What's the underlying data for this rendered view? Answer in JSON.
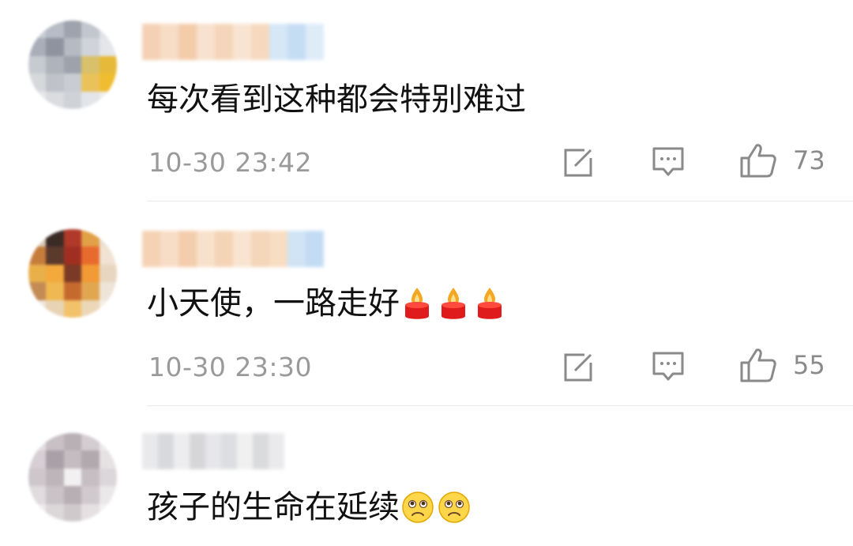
{
  "comments": [
    {
      "text": "每次看到这种都会特别难过",
      "emojis": [],
      "timestamp": "10-30 23:42",
      "likes": "73",
      "avatar_colors": [
        "#c9ccd3",
        "#b8bcc6",
        "#9ea3ad",
        "#c2c6cf",
        "#dfe1e5",
        "#a9aeb8",
        "#8e949f",
        "#b6bac3",
        "#d0d3d9",
        "#e4e6ea",
        "#c7cad1",
        "#aeb3bc",
        "#9da2ab",
        "#d8c16a",
        "#e7b93a",
        "#d6d8dc",
        "#bfc2c9",
        "#c9ccd2",
        "#e9c25a",
        "#f0bd31",
        "#e7e8ea",
        "#dadce0",
        "#cfd2d7",
        "#e4e5e8",
        "#eeeeef"
      ],
      "username_colors": [
        "#f3c9a8",
        "#f6d7bd",
        "#f1c49c",
        "#f7dcc6",
        "#f4cfae",
        "#f8e0cb",
        "#f5d2b4",
        "#cfe3f5",
        "#bcd8f2",
        "#d9e9f7"
      ]
    },
    {
      "text": "小天使，一路走好",
      "emojis": [
        "candle-icon",
        "candle-icon",
        "candle-icon"
      ],
      "timestamp": "10-30 23:30",
      "likes": "55",
      "avatar_colors": [
        "#d9c9b8",
        "#3a2b25",
        "#b1392a",
        "#e2a047",
        "#eadfd5",
        "#c67d3c",
        "#5b3a2c",
        "#a02f22",
        "#e86b2e",
        "#f0e3d3",
        "#e9b04a",
        "#f3a93b",
        "#7a3a26",
        "#f29a35",
        "#e8d6c0",
        "#c48b55",
        "#f0b850",
        "#c56a2f",
        "#e0a650",
        "#efe4d8",
        "#efe6dc",
        "#e8d3b5",
        "#f2c26a",
        "#ecd7b9",
        "#f5eee6"
      ],
      "username_colors": [
        "#f4cba8",
        "#f7d8bd",
        "#f2c59f",
        "#f7dcc4",
        "#f4cdaa",
        "#f8e0c9",
        "#f3cfad",
        "#f6d8b8",
        "#c8e0f4",
        "#b9d6f1"
      ]
    },
    {
      "text": "孩子的生命在延续",
      "emojis": [
        "sad-face-icon",
        "sad-face-icon"
      ],
      "timestamp": "",
      "likes": "",
      "avatar_colors": [
        "#e3dee0",
        "#c8c0c4",
        "#b9b0b6",
        "#d3ccd0",
        "#ece9eb",
        "#d6cfd3",
        "#aaa0a7",
        "#c4bcc1",
        "#b2a9af",
        "#e6e2e4",
        "#cdc6ca",
        "#bdb5ba",
        "#f2f0f1",
        "#c6bec3",
        "#dcd7da",
        "#e0dbdd",
        "#c9c2c6",
        "#b7afb4",
        "#d0c9cd",
        "#ebe8e9",
        "#eeebec",
        "#dcd7d9",
        "#cfc9cc",
        "#e5e1e3",
        "#f3f1f2"
      ],
      "username_colors": [
        "#e6e6e8",
        "#d2d3d6",
        "#ebebed",
        "#cfd0d3",
        "#e3e3e6",
        "#d8d9dc",
        "#eeeeef",
        "#d4d5d8",
        "#e7e7e9"
      ]
    }
  ],
  "icon_names": {
    "repost": "share-edit-icon",
    "reply": "comment-bubble-icon",
    "like": "thumbs-up-icon"
  },
  "colors": {
    "text": "#111111",
    "meta": "#9a9a9a",
    "icon": "#8a8a8a",
    "divider": "#e8e8e8"
  }
}
